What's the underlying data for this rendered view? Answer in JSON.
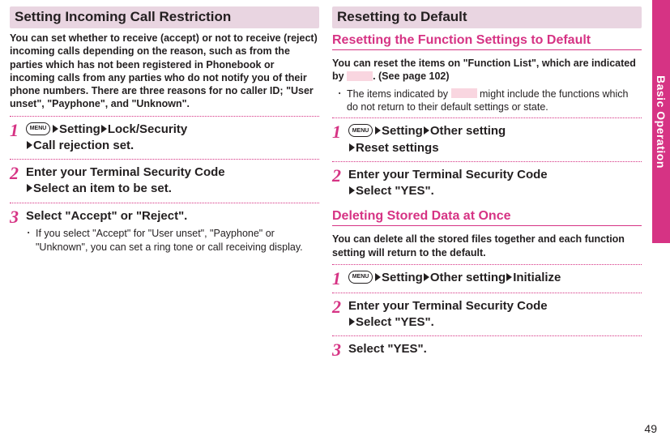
{
  "sideTab": "Basic Operation",
  "pageNumber": "49",
  "menuLabel": "MENU",
  "left": {
    "title": "Setting Incoming Call Restriction",
    "intro": "You can set whether to receive (accept) or not to receive (reject) incoming calls depending on the reason, such as from the parties which has not been registered in Phonebook or incoming calls from any parties who do not notify you of their phone numbers. There are three reasons for no caller ID; \"User unset\", \"Payphone\", and \"Unknown\".",
    "steps": {
      "s1": {
        "num": "1",
        "p1": "Setting",
        "p2": "Lock/Security",
        "p3": "Call rejection set."
      },
      "s2": {
        "num": "2",
        "l1": "Enter your Terminal Security Code",
        "l2": "Select an item to be set."
      },
      "s3": {
        "num": "3",
        "l1": "Select \"Accept\" or \"Reject\".",
        "note": "If you select \"Accept\" for \"User unset\", \"Payphone\" or \"Unknown\", you can set a ring tone or call receiving display."
      }
    }
  },
  "right": {
    "title": "Resetting to Default",
    "sub1": {
      "heading": "Resetting the Function Settings to Default",
      "intro1a": "You can reset the items on \"Function List\", which are indicated by ",
      "intro1b": ". (See page 102)",
      "note1a": "The items indicated by ",
      "note1b": " might include the functions which do not return to their default settings or state.",
      "steps": {
        "s1": {
          "num": "1",
          "p1": "Setting",
          "p2": "Other setting",
          "p3": "Reset settings"
        },
        "s2": {
          "num": "2",
          "l1": "Enter your Terminal Security Code",
          "l2": "Select \"YES\"."
        }
      }
    },
    "sub2": {
      "heading": "Deleting Stored Data at Once",
      "intro": "You can delete all the stored files together and each function setting will return to the default.",
      "steps": {
        "s1": {
          "num": "1",
          "p1": "Setting",
          "p2": "Other setting",
          "p3": "Initialize"
        },
        "s2": {
          "num": "2",
          "l1": "Enter your Terminal Security Code",
          "l2": "Select \"YES\"."
        },
        "s3": {
          "num": "3",
          "l1": "Select \"YES\"."
        }
      }
    }
  }
}
